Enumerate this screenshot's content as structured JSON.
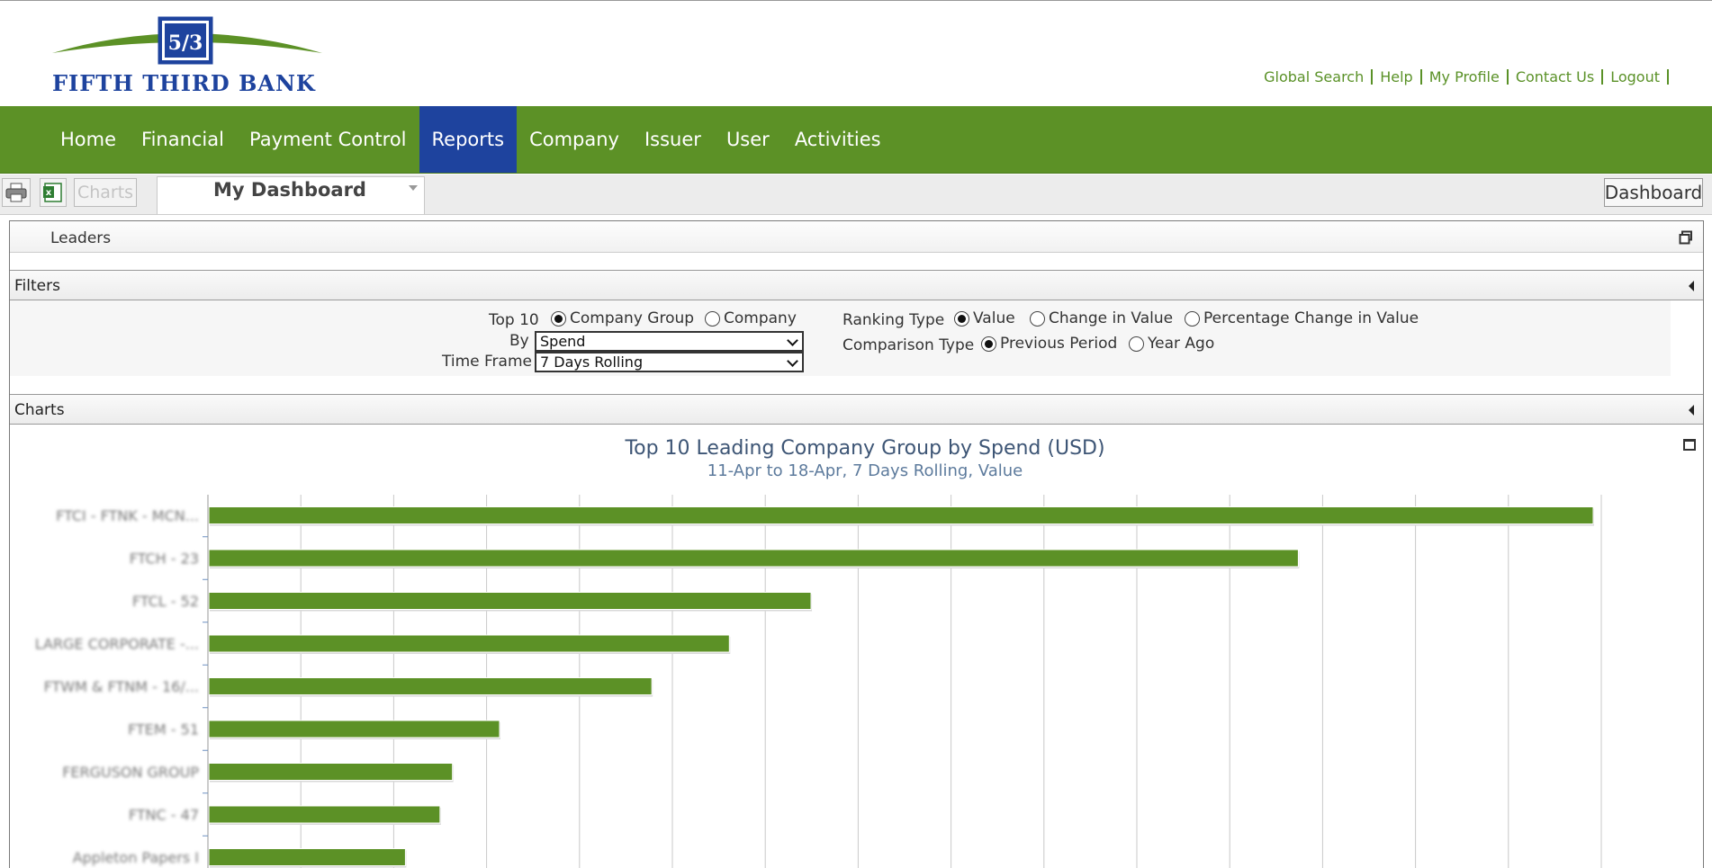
{
  "header": {
    "logo_text": "FIFTH THIRD BANK",
    "logo_mark": "5/3",
    "links": [
      "Global Search",
      "Help",
      "My Profile",
      "Contact Us",
      "Logout"
    ]
  },
  "nav": {
    "items": [
      "Home",
      "Financial",
      "Payment Control",
      "Reports",
      "Company",
      "Issuer",
      "User",
      "Activities"
    ],
    "active": "Reports"
  },
  "toolbar": {
    "charts_label": "Charts",
    "tab_label": "My Dashboard",
    "dashboard_label": "Dashboard"
  },
  "panel": {
    "title": "Leaders",
    "filters_label": "Filters",
    "charts_label": "Charts"
  },
  "filters": {
    "top_label": "Top 10",
    "top_options": [
      "Company Group",
      "Company"
    ],
    "top_selected": "Company Group",
    "by_label": "By",
    "by_value": "Spend",
    "timeframe_label": "Time Frame",
    "timeframe_value": "7 Days Rolling",
    "ranking_label": "Ranking Type",
    "ranking_options": [
      "Value",
      "Change in Value",
      "Percentage Change in Value"
    ],
    "ranking_selected": "Value",
    "comparison_label": "Comparison Type",
    "comparison_options": [
      "Previous Period",
      "Year Ago"
    ],
    "comparison_selected": "Previous Period"
  },
  "chart_data": {
    "type": "bar",
    "orientation": "horizontal",
    "title": "Top 10 Leading Company Group by Spend (USD)",
    "subtitle": "11-Apr to 18-Apr, 7 Days Rolling, Value",
    "categories": [
      "FTCI - FTNK - MCN...",
      "FTCH - 23",
      "FTCL - 52",
      "LARGE CORPORATE -...",
      "FTWM & FTNM - 16/...",
      "FTEM - 51",
      "FERGUSON GROUP",
      "FTNC - 47",
      "Appleton Papers I"
    ],
    "values": [
      1.0,
      0.787,
      0.435,
      0.376,
      0.32,
      0.21,
      0.176,
      0.167,
      0.142
    ],
    "value_scale": "relative to largest bar (axis values not visible)",
    "grid": true,
    "color": "#5c9126"
  }
}
